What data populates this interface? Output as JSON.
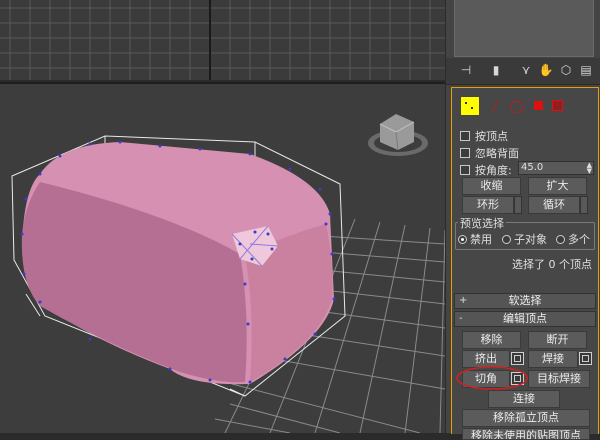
{
  "panel": {
    "preview_selection": {
      "title": "预览选择",
      "options": [
        "禁用",
        "子对象",
        "多个"
      ],
      "selected": "禁用"
    },
    "checkboxes": {
      "by_vertex": "按顶点",
      "ignore_backface": "忽略背面",
      "by_angle": "按角度:",
      "angle_value": "45.0"
    },
    "buttons": {
      "shrink": "收缩",
      "grow": "扩大",
      "ring": "环形",
      "loop": "循环",
      "remove": "移除",
      "break": "断开",
      "extrude": "挤出",
      "weld": "焊接",
      "chamfer": "切角",
      "target_weld": "目标焊接",
      "connect": "连接",
      "remove_isolated": "移除孤立顶点",
      "remove_unused": "移除未使用的贴图顶点"
    },
    "status": "选择了 0 个顶点",
    "rollouts": {
      "soft_selection": "软选择",
      "soft_selection_sign": "+",
      "edit_vertices": "编辑顶点",
      "edit_vertices_sign": "-"
    },
    "colors": {
      "active_vertex": "#ffff00",
      "subobject_red": "#e01010",
      "annotation_red": "#d42020",
      "mesh_pink": "#d590b2",
      "highlight_border": "#e3a000"
    }
  }
}
